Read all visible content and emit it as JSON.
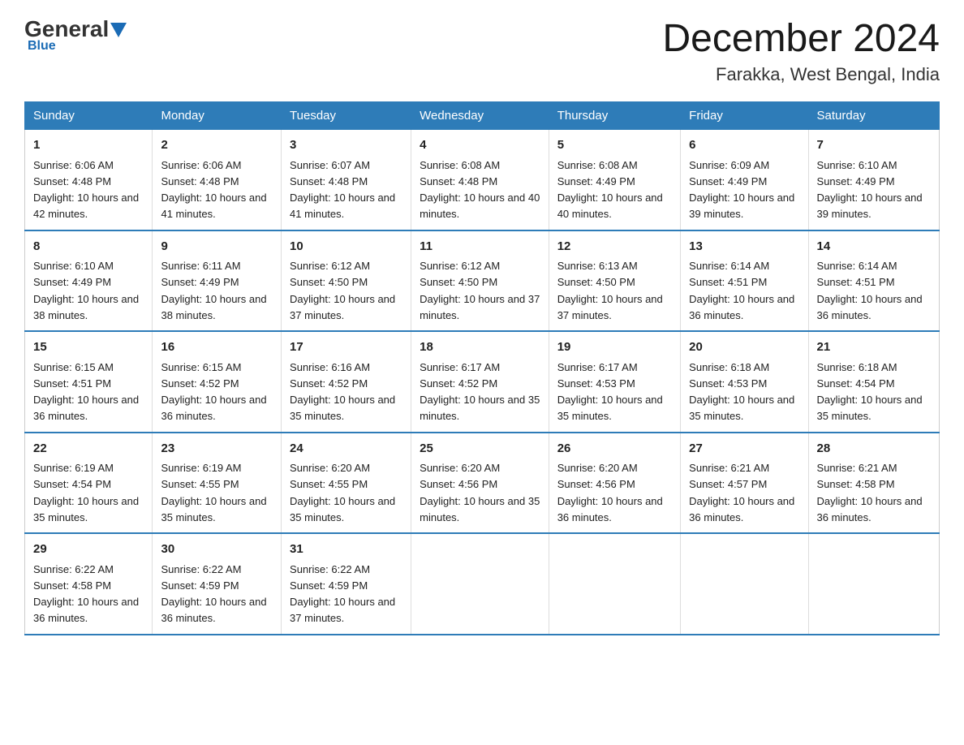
{
  "header": {
    "logo": {
      "general": "General",
      "blue": "Blue"
    },
    "month_year": "December 2024",
    "location": "Farakka, West Bengal, India"
  },
  "weekdays": [
    "Sunday",
    "Monday",
    "Tuesday",
    "Wednesday",
    "Thursday",
    "Friday",
    "Saturday"
  ],
  "weeks": [
    [
      {
        "day": "1",
        "sunrise": "6:06 AM",
        "sunset": "4:48 PM",
        "daylight": "10 hours and 42 minutes."
      },
      {
        "day": "2",
        "sunrise": "6:06 AM",
        "sunset": "4:48 PM",
        "daylight": "10 hours and 41 minutes."
      },
      {
        "day": "3",
        "sunrise": "6:07 AM",
        "sunset": "4:48 PM",
        "daylight": "10 hours and 41 minutes."
      },
      {
        "day": "4",
        "sunrise": "6:08 AM",
        "sunset": "4:48 PM",
        "daylight": "10 hours and 40 minutes."
      },
      {
        "day": "5",
        "sunrise": "6:08 AM",
        "sunset": "4:49 PM",
        "daylight": "10 hours and 40 minutes."
      },
      {
        "day": "6",
        "sunrise": "6:09 AM",
        "sunset": "4:49 PM",
        "daylight": "10 hours and 39 minutes."
      },
      {
        "day": "7",
        "sunrise": "6:10 AM",
        "sunset": "4:49 PM",
        "daylight": "10 hours and 39 minutes."
      }
    ],
    [
      {
        "day": "8",
        "sunrise": "6:10 AM",
        "sunset": "4:49 PM",
        "daylight": "10 hours and 38 minutes."
      },
      {
        "day": "9",
        "sunrise": "6:11 AM",
        "sunset": "4:49 PM",
        "daylight": "10 hours and 38 minutes."
      },
      {
        "day": "10",
        "sunrise": "6:12 AM",
        "sunset": "4:50 PM",
        "daylight": "10 hours and 37 minutes."
      },
      {
        "day": "11",
        "sunrise": "6:12 AM",
        "sunset": "4:50 PM",
        "daylight": "10 hours and 37 minutes."
      },
      {
        "day": "12",
        "sunrise": "6:13 AM",
        "sunset": "4:50 PM",
        "daylight": "10 hours and 37 minutes."
      },
      {
        "day": "13",
        "sunrise": "6:14 AM",
        "sunset": "4:51 PM",
        "daylight": "10 hours and 36 minutes."
      },
      {
        "day": "14",
        "sunrise": "6:14 AM",
        "sunset": "4:51 PM",
        "daylight": "10 hours and 36 minutes."
      }
    ],
    [
      {
        "day": "15",
        "sunrise": "6:15 AM",
        "sunset": "4:51 PM",
        "daylight": "10 hours and 36 minutes."
      },
      {
        "day": "16",
        "sunrise": "6:15 AM",
        "sunset": "4:52 PM",
        "daylight": "10 hours and 36 minutes."
      },
      {
        "day": "17",
        "sunrise": "6:16 AM",
        "sunset": "4:52 PM",
        "daylight": "10 hours and 35 minutes."
      },
      {
        "day": "18",
        "sunrise": "6:17 AM",
        "sunset": "4:52 PM",
        "daylight": "10 hours and 35 minutes."
      },
      {
        "day": "19",
        "sunrise": "6:17 AM",
        "sunset": "4:53 PM",
        "daylight": "10 hours and 35 minutes."
      },
      {
        "day": "20",
        "sunrise": "6:18 AM",
        "sunset": "4:53 PM",
        "daylight": "10 hours and 35 minutes."
      },
      {
        "day": "21",
        "sunrise": "6:18 AM",
        "sunset": "4:54 PM",
        "daylight": "10 hours and 35 minutes."
      }
    ],
    [
      {
        "day": "22",
        "sunrise": "6:19 AM",
        "sunset": "4:54 PM",
        "daylight": "10 hours and 35 minutes."
      },
      {
        "day": "23",
        "sunrise": "6:19 AM",
        "sunset": "4:55 PM",
        "daylight": "10 hours and 35 minutes."
      },
      {
        "day": "24",
        "sunrise": "6:20 AM",
        "sunset": "4:55 PM",
        "daylight": "10 hours and 35 minutes."
      },
      {
        "day": "25",
        "sunrise": "6:20 AM",
        "sunset": "4:56 PM",
        "daylight": "10 hours and 35 minutes."
      },
      {
        "day": "26",
        "sunrise": "6:20 AM",
        "sunset": "4:56 PM",
        "daylight": "10 hours and 36 minutes."
      },
      {
        "day": "27",
        "sunrise": "6:21 AM",
        "sunset": "4:57 PM",
        "daylight": "10 hours and 36 minutes."
      },
      {
        "day": "28",
        "sunrise": "6:21 AM",
        "sunset": "4:58 PM",
        "daylight": "10 hours and 36 minutes."
      }
    ],
    [
      {
        "day": "29",
        "sunrise": "6:22 AM",
        "sunset": "4:58 PM",
        "daylight": "10 hours and 36 minutes."
      },
      {
        "day": "30",
        "sunrise": "6:22 AM",
        "sunset": "4:59 PM",
        "daylight": "10 hours and 36 minutes."
      },
      {
        "day": "31",
        "sunrise": "6:22 AM",
        "sunset": "4:59 PM",
        "daylight": "10 hours and 37 minutes."
      },
      {
        "day": "",
        "sunrise": "",
        "sunset": "",
        "daylight": ""
      },
      {
        "day": "",
        "sunrise": "",
        "sunset": "",
        "daylight": ""
      },
      {
        "day": "",
        "sunrise": "",
        "sunset": "",
        "daylight": ""
      },
      {
        "day": "",
        "sunrise": "",
        "sunset": "",
        "daylight": ""
      }
    ]
  ],
  "labels": {
    "sunrise": "Sunrise:",
    "sunset": "Sunset:",
    "daylight": "Daylight:"
  }
}
